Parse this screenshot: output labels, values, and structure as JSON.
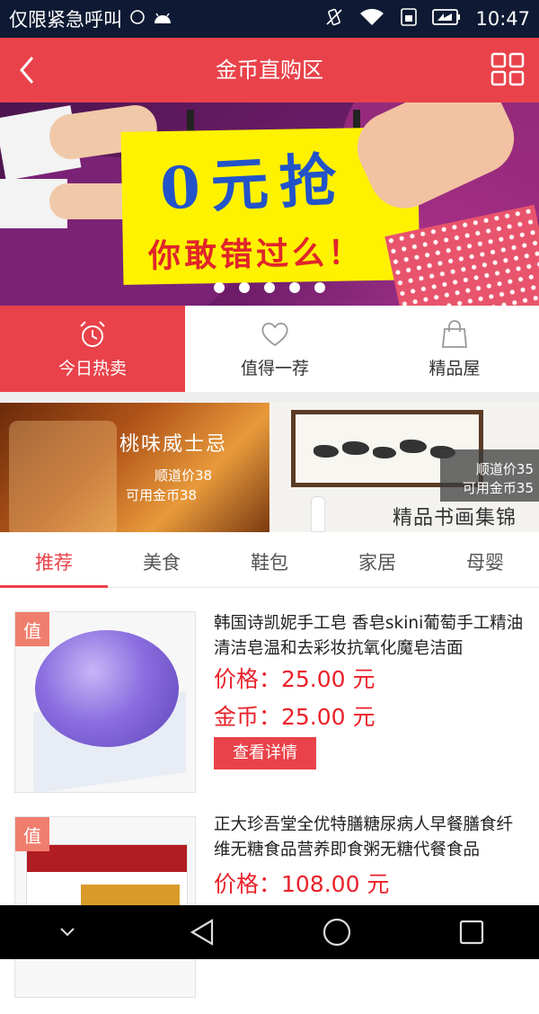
{
  "status_bar": {
    "carrier": "仅限紧急呼叫",
    "time": "10:47"
  },
  "header": {
    "title": "金币直购区"
  },
  "banner": {
    "headline": "0元抢",
    "subline": "你敢错过么！",
    "active_slide": 1,
    "slide_count": 5
  },
  "categories": [
    {
      "label": "今日热卖",
      "icon": "alarm-clock-icon",
      "active": true
    },
    {
      "label": "值得一荐",
      "icon": "heart-icon",
      "active": false
    },
    {
      "label": "精品屋",
      "icon": "shopping-bag-icon",
      "active": false
    }
  ],
  "promos": [
    {
      "title": "桃味威士忌",
      "price_line": "顺道价38",
      "coin_line": "可用金币38"
    },
    {
      "title": "精品书画集锦",
      "price_line": "顺道价35",
      "coin_line": "可用金币35"
    }
  ],
  "tabs": [
    {
      "label": "推荐",
      "active": true
    },
    {
      "label": "美食",
      "active": false
    },
    {
      "label": "鞋包",
      "active": false
    },
    {
      "label": "家居",
      "active": false
    },
    {
      "label": "母婴",
      "active": false
    }
  ],
  "products": [
    {
      "badge": "值",
      "name": "韩国诗凯妮手工皂 香皂skini葡萄手工精油清洁皂温和去彩妆抗氧化魔皂洁面",
      "price": "价格：25.00 元",
      "coins": "金币：25.00 元",
      "button": "查看详情"
    },
    {
      "badge": "值",
      "name": "正大珍吾堂全优特膳糖尿病人早餐膳食纤维无糖食品营养即食粥无糖代餐食品",
      "price": "价格：108.00 元"
    }
  ],
  "colors": {
    "primary": "#e9424a",
    "status_bar": "#0e1a33",
    "price": "#e9222a",
    "badge": "#f07e6e"
  }
}
